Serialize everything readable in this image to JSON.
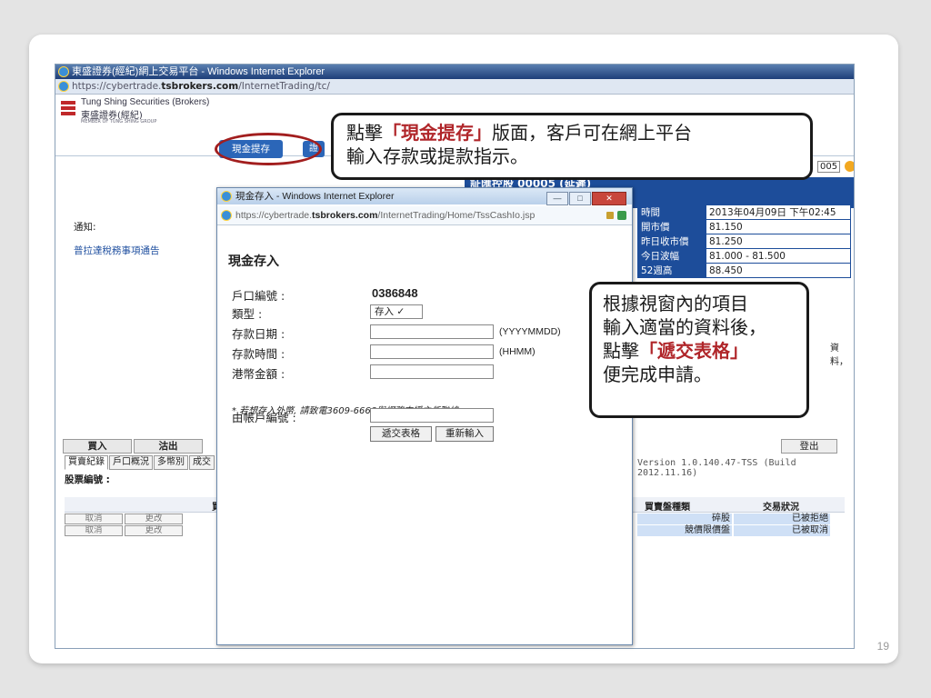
{
  "slide": {
    "page_number": "19"
  },
  "window": {
    "title": "東盛證券(經紀)網上交易平台 - Windows Internet Explorer",
    "url_prefix": "https://cybertrade.",
    "url_domain": "tsbrokers.com",
    "url_suffix": "/InternetTrading/tc/"
  },
  "brand": {
    "name_en": "Tung Shing Securities (Brokers)",
    "name_zh": "東盛證券(經紀)",
    "tagline": "MEMBER OF TUNG SHING GROUP"
  },
  "nav": {
    "cash_button": "現金提存",
    "next_button": "證"
  },
  "left_panel": {
    "notice_label": "通知:",
    "notice_link": "普拉達稅務事項通告"
  },
  "quote": {
    "header": "証匯控股 00005 (延遲)",
    "account_tail": "005",
    "rows": [
      {
        "k": "時間",
        "v": "2013年04月09日 下午02:45"
      },
      {
        "k": "開市價",
        "v": "81.150"
      },
      {
        "k": "昨日收市價",
        "v": "81.250"
      },
      {
        "k": "今日波幅",
        "v": "81.000 - 81.500"
      },
      {
        "k": "52週高",
        "v": "88.450"
      }
    ],
    "right_tail": "資料，"
  },
  "bottom": {
    "buy": "買入",
    "sell": "沽出",
    "tabs": [
      "買賣紀錄",
      "戶口概況",
      "多幣別",
      "成交"
    ],
    "stock_label": "股票編號 :",
    "version": "Version 1.0.140.47-TSS (Build 2012.11.16)",
    "logout": "登出",
    "col_side": "買",
    "col_type": "買賣盤種類",
    "col_status": "交易狀況",
    "rows": [
      {
        "cancel": "取消",
        "modify": "更改",
        "type": "碎股",
        "status": "已被拒絕"
      },
      {
        "cancel": "取消",
        "modify": "更改",
        "type": "競價限價盤",
        "status": "已被取消"
      }
    ]
  },
  "popup": {
    "title": "現金存入 - Windows Internet Explorer",
    "url_prefix": "https://cybertrade.",
    "url_domain": "tsbrokers.com",
    "url_suffix": "/InternetTrading/Home/TssCashIo.jsp",
    "heading": "現金存入",
    "labels": {
      "account": "戶口編號 :",
      "type": "類型 :",
      "date": "存款日期 :",
      "time": "存款時間 :",
      "amount": "港幣金額 :",
      "from_account": "由帳戶編號 :"
    },
    "account_number": "0386848",
    "type_value": "存入 ✓",
    "date_format": "(YYYYMMDD)",
    "time_format": "(HHMM)",
    "note": "* 若想存入外幣, 請致電3609-6666與網務支援主任聯絡",
    "submit": "遞交表格",
    "reset": "重新輸入"
  },
  "callout1": {
    "line1_pre": "點擊",
    "line1_hl": "「現金提存」",
    "line1_post": "版面，客戶可在網上平台",
    "line2": "輸入存款或提款指示。"
  },
  "callout2": {
    "line1": "根據視窗內的項目",
    "line2": "輸入適當的資料後，",
    "line3_pre": "點擊",
    "line3_hl": "「遞交表格」",
    "line4": "便完成申請。"
  }
}
